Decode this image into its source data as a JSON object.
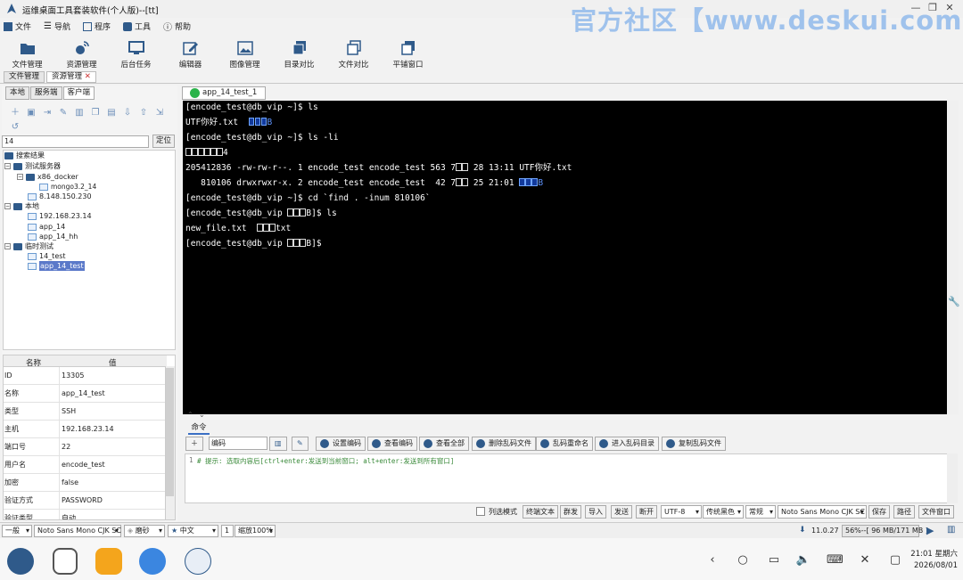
{
  "window": {
    "title": "运维桌面工具套装软件(个人版)--[tt]",
    "watermark": "官方社区【www.deskui.com】"
  },
  "menu": [
    "文件",
    "导航",
    "程序",
    "工具",
    "帮助"
  ],
  "toolbar": [
    "文件管理",
    "资源管理",
    "后台任务",
    "编辑器",
    "图像管理",
    "目录对比",
    "文件对比",
    "平铺窗口"
  ],
  "top_tabs": [
    "文件管理",
    "资源管理"
  ],
  "left_tabs": [
    "本地",
    "服务端",
    "客户端"
  ],
  "search": {
    "value": "14",
    "locate_label": "定位"
  },
  "tree": {
    "root": "搜索结果",
    "group1": "测试服务器",
    "docker": "x86_docker",
    "mongo": "mongo3.2_14",
    "ip1": "8.148.150.230",
    "group2": "本地",
    "ip2": "192.168.23.14",
    "app14": "app_14",
    "app14hh": "app_14_hh",
    "group3": "临时测试",
    "t14": "14_test",
    "app14test": "app_14_test"
  },
  "props": {
    "header_name": "名称",
    "header_value": "值",
    "rows": [
      {
        "k": "ID",
        "v": "13305"
      },
      {
        "k": "名称",
        "v": "app_14_test"
      },
      {
        "k": "类型",
        "v": "SSH"
      },
      {
        "k": "主机",
        "v": "192.168.23.14"
      },
      {
        "k": "端口号",
        "v": "22"
      },
      {
        "k": "用户名",
        "v": "encode_test"
      },
      {
        "k": "加密",
        "v": "false"
      },
      {
        "k": "验证方式",
        "v": "PASSWORD"
      },
      {
        "k": "验证类型",
        "v": "自动"
      }
    ]
  },
  "editor_tab": "app_14_test_1",
  "terminal": {
    "l1": "[encode_test@db_vip ~]$ ls",
    "l2": "UTF你好.txt",
    "l2b": "B",
    "l3": "[encode_test@db_vip ~]$ ls -li",
    "l4": "4",
    "l5": "205412836 -rw-rw-r--. 1 encode_test encode_test 563 7",
    "l5b": " 28 13:11 UTF你好.txt",
    "l6": "   810106 drwxrwxr-x. 2 encode_test encode_test  42 7",
    "l6b": " 25 21:01 ",
    "l6c": "B",
    "l7": "[encode_test@db_vip ~]$ cd `find . -inum 810106`",
    "l8a": "[encode_test@db_vip ",
    "l8b": "B]$ ls",
    "l9a": "new_file.txt  ",
    "l9b": "txt",
    "l10a": "[encode_test@db_vip ",
    "l10b": "B]$"
  },
  "cmd": {
    "tab": "命令",
    "input_value": "编码",
    "buttons": [
      "设置编码",
      "查看编码",
      "查看全部",
      "删除乱码文件",
      "乱码重命名",
      "进入乱码目录",
      "复制乱码文件"
    ],
    "line_no": "1",
    "hint": "# 提示: 选取内容后[ctrl+enter:发送到当前窗口; alt+enter:发送到所有窗口]",
    "controls": [
      "列选模式",
      "终端文本",
      "群发",
      "导入",
      "发送",
      "断开"
    ],
    "encoding": "UTF-8",
    "theme": "传统黑色",
    "style": "常规",
    "font": "Noto Sans Mono CJK SC",
    "save": "保存",
    "path": "路径",
    "file_window": "文件窗口"
  },
  "status": {
    "mode": "一般",
    "font": "Noto Sans Mono CJK SC",
    "polish": "磨砂",
    "lang": "中文",
    "zoom_num": "1",
    "zoom": "缩放100%",
    "version": "11.0.27",
    "mem": "56%--[ 96 MB/171 MB ]"
  },
  "clock": {
    "time": "21:01 星期六",
    "date": "2026/08/01"
  }
}
